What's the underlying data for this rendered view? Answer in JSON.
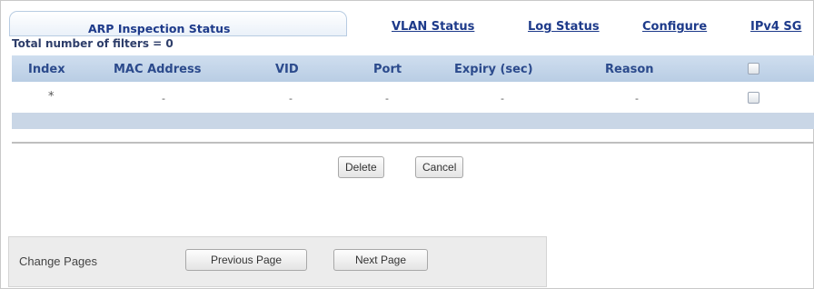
{
  "tabs": {
    "active": "ARP Inspection Status",
    "links": [
      "VLAN Status",
      "Log Status",
      "Configure",
      "IPv4 SG"
    ]
  },
  "summary": {
    "total_filters": "Total number of filters = 0"
  },
  "table": {
    "columns": [
      "Index",
      "MAC Address",
      "VID",
      "Port",
      "Expiry (sec)",
      "Reason"
    ],
    "rows": [
      {
        "index": "*",
        "mac": "-",
        "vid": "-",
        "port": "-",
        "expiry": "-",
        "reason": "-"
      }
    ]
  },
  "actions": {
    "delete": "Delete",
    "cancel": "Cancel"
  },
  "pager": {
    "label": "Change Pages",
    "previous": "Previous Page",
    "next": "Next Page"
  }
}
